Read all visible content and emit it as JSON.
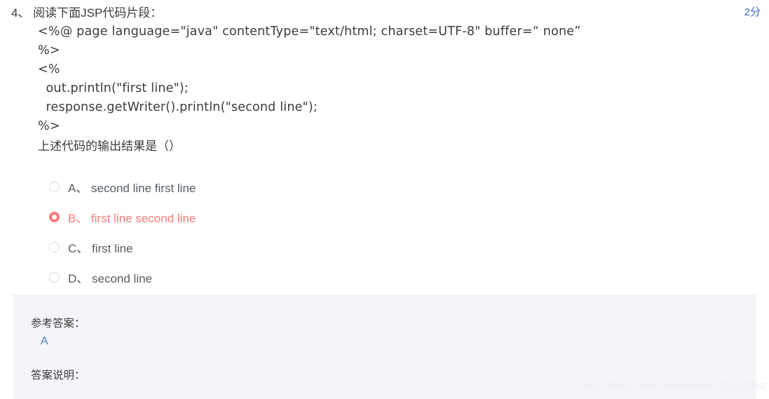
{
  "question": {
    "number_prefix": "4、",
    "title": "阅读下面JSP代码片段：",
    "header_line": "4、 阅读下面JSP代码片段：",
    "score_badge": "2分",
    "code": "<%@ page language=\"java\" contentType=\"text/html; charset=UTF-8\" buffer=“ none”\n%>\n<%\n  out.println(\"first line\");\n  response.getWriter().println(\"second line\");\n%>",
    "prompt": "上述代码的输出结果是（）"
  },
  "options": [
    {
      "letter": "A、",
      "text": "second line first line",
      "label": "A、 second line first line",
      "selected": false
    },
    {
      "letter": "B、",
      "text": "first line second line",
      "label": "B、 first line second line",
      "selected": true
    },
    {
      "letter": "C、",
      "text": "first line",
      "label": "C、 first line",
      "selected": false
    },
    {
      "letter": "D、",
      "text": "second line",
      "label": "D、 second line",
      "selected": false
    }
  ],
  "answer_panel": {
    "reference_answer_label": "参考答案：",
    "reference_answer_value": "A",
    "explanation_label": "答案说明：",
    "explanation_value": ""
  },
  "watermark": "https://blog.csdn.net/weixin_43330588",
  "colors": {
    "selected_option": "#fa7a78",
    "score_badge": "#3a6fb8",
    "answer_value": "#4a7fc1",
    "panel_background": "#f4f5f9",
    "body_text": "#3c3c3c"
  }
}
